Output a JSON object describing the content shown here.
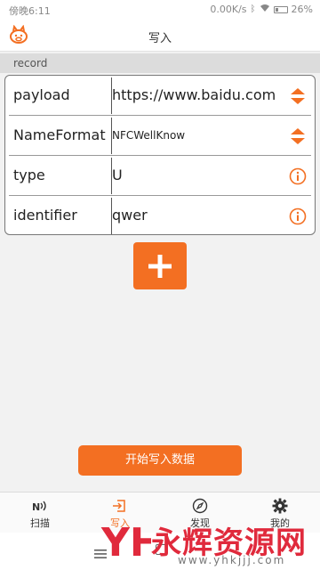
{
  "status_bar": {
    "time": "傍晚6:11",
    "net_speed": "0.00K/s",
    "battery": "26%"
  },
  "app_bar": {
    "title": "写入",
    "logo_icon": "piggy-logo-icon"
  },
  "record_section": {
    "header": "record",
    "rows": [
      {
        "label": "payload",
        "value": "https://www.baidu.com",
        "icon": "sort-arrows-icon"
      },
      {
        "label": "NameFormat",
        "value": "NFCWellKnow",
        "icon": "sort-arrows-icon"
      },
      {
        "label": "type",
        "value": "U",
        "icon": "info-icon"
      },
      {
        "label": "identifier",
        "value": "qwer",
        "icon": "info-icon"
      }
    ]
  },
  "add_button": {
    "icon": "plus-icon"
  },
  "start_button": {
    "label": "开始写入数据"
  },
  "bottom_nav": {
    "tabs": [
      {
        "label": "扫描",
        "icon": "nfc-icon"
      },
      {
        "label": "写入",
        "icon": "write-icon"
      },
      {
        "label": "发现",
        "icon": "compass-icon"
      },
      {
        "label": "我的",
        "icon": "gear-icon"
      }
    ],
    "active_tab": "写入"
  },
  "watermark": {
    "text": "永辉资源网",
    "url": "www.yhkjjj.com",
    "mark": "YH"
  },
  "colors": {
    "accent": "#f36f22",
    "watermark": "#e02a3c"
  }
}
